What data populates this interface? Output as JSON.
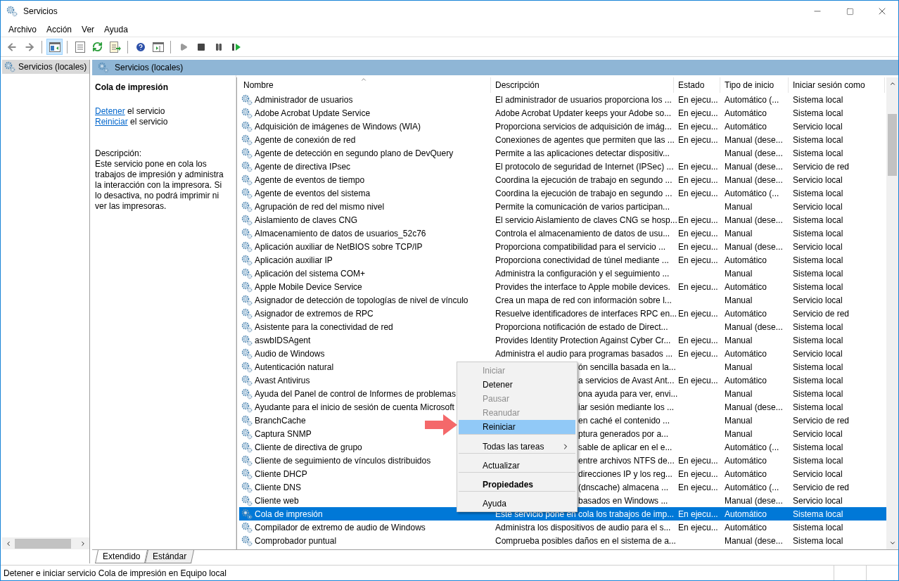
{
  "window": {
    "title": "Servicios"
  },
  "menu_bar": [
    "Archivo",
    "Acción",
    "Ver",
    "Ayuda"
  ],
  "toolbar": {
    "console_tree_shown": true
  },
  "tree": [
    {
      "label": "Servicios (locales)",
      "selected": true
    }
  ],
  "panel_title": "Servicios (locales)",
  "details": {
    "service_name": "Cola de impresión",
    "actions": [
      {
        "link": "Detener",
        "text": "el servicio"
      },
      {
        "link": "Reiniciar",
        "text": "el servicio"
      }
    ],
    "description_label": "Descripción:",
    "description": "Este servicio pone en cola los trabajos de impresión y administra la interacción con la impresora. Si lo desactiva, no podrá imprimir ni ver las impresoras."
  },
  "table": {
    "columns": [
      "Nombre",
      "Descripción",
      "Estado",
      "Tipo de inicio",
      "Iniciar sesión como"
    ],
    "rows": [
      {
        "name": "Administrador de usuarios",
        "description": "El administrador de usuarios proporciona los ...",
        "status": "En ejecu...",
        "startup": "Automático (...",
        "logon": "Sistema local",
        "selected": false,
        "covered": false
      },
      {
        "name": "Adobe Acrobat Update Service",
        "description": "Adobe Acrobat Updater keeps your Adobe so...",
        "status": "En ejecu...",
        "startup": "Automático",
        "logon": "Sistema local",
        "selected": false,
        "covered": false
      },
      {
        "name": "Adquisición de imágenes de Windows (WIA)",
        "description": "Proporciona servicios de adquisición de imág...",
        "status": "En ejecu...",
        "startup": "Automático",
        "logon": "Servicio local",
        "selected": false,
        "covered": false
      },
      {
        "name": "Agente de conexión de red",
        "description": "Conexiones de agentes que permiten que las ...",
        "status": "En ejecu...",
        "startup": "Manual (dese...",
        "logon": "Sistema local",
        "selected": false,
        "covered": false
      },
      {
        "name": "Agente de detección en segundo plano de DevQuery",
        "description": "Permite a las aplicaciones detectar dispositiv...",
        "status": "",
        "startup": "Manual (dese...",
        "logon": "Sistema local",
        "selected": false,
        "covered": false
      },
      {
        "name": "Agente de directiva IPsec",
        "description": "El protocolo de seguridad de Internet (IPSec) ...",
        "status": "En ejecu...",
        "startup": "Manual (dese...",
        "logon": "Servicio de red",
        "selected": false,
        "covered": false
      },
      {
        "name": "Agente de eventos de tiempo",
        "description": "Coordina la ejecución de trabajo en segundo ...",
        "status": "En ejecu...",
        "startup": "Manual (dese...",
        "logon": "Servicio local",
        "selected": false,
        "covered": false
      },
      {
        "name": "Agente de eventos del sistema",
        "description": "Coordina la ejecución de trabajo en segundo ...",
        "status": "En ejecu...",
        "startup": "Automático (...",
        "logon": "Sistema local",
        "selected": false,
        "covered": false
      },
      {
        "name": "Agrupación de red del mismo nivel",
        "description": "Permite la comunicación de varios participan...",
        "status": "",
        "startup": "Manual",
        "logon": "Servicio local",
        "selected": false,
        "covered": false
      },
      {
        "name": "Aislamiento de claves CNG",
        "description": "El servicio Aislamiento de claves CNG se hosp...",
        "status": "En ejecu...",
        "startup": "Manual (dese...",
        "logon": "Sistema local",
        "selected": false,
        "covered": false
      },
      {
        "name": "Almacenamiento de datos de usuarios_52c76",
        "description": "Controla el almacenamiento de datos de usu...",
        "status": "En ejecu...",
        "startup": "Manual",
        "logon": "Sistema local",
        "selected": false,
        "covered": false
      },
      {
        "name": "Aplicación auxiliar de NetBIOS sobre TCP/IP",
        "description": "Proporciona compatibilidad para el servicio ...",
        "status": "En ejecu...",
        "startup": "Manual (dese...",
        "logon": "Servicio local",
        "selected": false,
        "covered": false
      },
      {
        "name": "Aplicación auxiliar IP",
        "description": "Proporciona conectividad de túnel mediante ...",
        "status": "En ejecu...",
        "startup": "Automático",
        "logon": "Sistema local",
        "selected": false,
        "covered": false
      },
      {
        "name": "Aplicación del sistema COM+",
        "description": "Administra la configuración y el seguimiento ...",
        "status": "",
        "startup": "Manual",
        "logon": "Sistema local",
        "selected": false,
        "covered": false
      },
      {
        "name": "Apple Mobile Device Service",
        "description": "Provides the interface to Apple mobile devices.",
        "status": "En ejecu...",
        "startup": "Automático",
        "logon": "Sistema local",
        "selected": false,
        "covered": false
      },
      {
        "name": "Asignador de detección de topologías de nivel de vínculo",
        "description": "Crea un mapa de red con información sobre l...",
        "status": "",
        "startup": "Manual",
        "logon": "Servicio local",
        "selected": false,
        "covered": false
      },
      {
        "name": "Asignador de extremos de RPC",
        "description": "Resuelve identificadores de interfaces RPC en...",
        "status": "En ejecu...",
        "startup": "Automático",
        "logon": "Servicio de red",
        "selected": false,
        "covered": false
      },
      {
        "name": "Asistente para la conectividad de red",
        "description": "Proporciona notificación de estado de Direct...",
        "status": "",
        "startup": "Manual (dese...",
        "logon": "Sistema local",
        "selected": false,
        "covered": false
      },
      {
        "name": "aswbIDSAgent",
        "description": "Provides Identity Protection Against Cyber Cr...",
        "status": "En ejecu...",
        "startup": "Manual",
        "logon": "Sistema local",
        "selected": false,
        "covered": false
      },
      {
        "name": "Audio de Windows",
        "description": "Administra el audio para programas basados ...",
        "status": "En ejecu...",
        "startup": "Automático",
        "logon": "Servicio local",
        "selected": false,
        "covered": false
      },
      {
        "name": "Autenticación natural",
        "description": "ón sencilla basada en la...",
        "status": "",
        "startup": "Manual",
        "logon": "Sistema local",
        "selected": false,
        "covered": true
      },
      {
        "name": "Avast Antivirus",
        "description": "a servicios de Avast Ant...",
        "status": "En ejecu...",
        "startup": "Automático",
        "logon": "Sistema local",
        "selected": false,
        "covered": true
      },
      {
        "name": "Ayuda del Panel de control de Informes de problemas",
        "description": "ona ayuda para ver, envi...",
        "status": "",
        "startup": "Manual",
        "logon": "Sistema local",
        "selected": false,
        "covered": true
      },
      {
        "name": "Ayudante para el inicio de sesión de cuenta Microsoft",
        "description": "iar sesión mediante los ...",
        "status": "",
        "startup": "Manual (dese...",
        "logon": "Sistema local",
        "selected": false,
        "covered": true
      },
      {
        "name": "BranchCache",
        "description": "en caché el contenido ...",
        "status": "",
        "startup": "Manual",
        "logon": "Servicio de red",
        "selected": false,
        "covered": true
      },
      {
        "name": "Captura SNMP",
        "description": "ptura generados por a...",
        "status": "",
        "startup": "Manual",
        "logon": "Servicio local",
        "selected": false,
        "covered": true
      },
      {
        "name": "Cliente de directiva de grupo",
        "description": "sable de aplicar en el e...",
        "status": "",
        "startup": "Automático (...",
        "logon": "Sistema local",
        "selected": false,
        "covered": true
      },
      {
        "name": "Cliente de seguimiento de vínculos distribuidos",
        "description": "entre archivos NTFS de...",
        "status": "En ejecu...",
        "startup": "Automático",
        "logon": "Sistema local",
        "selected": false,
        "covered": true
      },
      {
        "name": "Cliente DHCP",
        "description": "direcciones IP y los reg...",
        "status": "En ejecu...",
        "startup": "Automático",
        "logon": "Servicio local",
        "selected": false,
        "covered": true
      },
      {
        "name": "Cliente DNS",
        "description": "(dnscache) almacena ...",
        "status": "En ejecu...",
        "startup": "Automático (...",
        "logon": "Servicio de red",
        "selected": false,
        "covered": true
      },
      {
        "name": "Cliente web",
        "description": "basados en Windows ...",
        "status": "",
        "startup": "Manual (dese...",
        "logon": "Servicio local",
        "selected": false,
        "covered": true
      },
      {
        "name": "Cola de impresión",
        "description": "Este servicio pone en cola los trabajos de imp...",
        "status": "En ejecu...",
        "startup": "Automático",
        "logon": "Sistema local",
        "selected": true,
        "covered": false
      },
      {
        "name": "Compilador de extremo de audio de Windows",
        "description": "Administra los dispositivos de audio para el s...",
        "status": "En ejecu...",
        "startup": "Automático",
        "logon": "Sistema local",
        "selected": false,
        "covered": false
      },
      {
        "name": "Comprobador puntual",
        "description": "Comprueba posibles daños en el sistema de a...",
        "status": "",
        "startup": "Manual (dese...",
        "logon": "Sistema local",
        "selected": false,
        "covered": false
      }
    ]
  },
  "context_menu": [
    {
      "label": "Iniciar",
      "disabled": true,
      "selected": false,
      "separator_before": false,
      "submenu": false,
      "default": false
    },
    {
      "label": "Detener",
      "disabled": false,
      "selected": false,
      "separator_before": false,
      "submenu": false,
      "default": false
    },
    {
      "label": "Pausar",
      "disabled": true,
      "selected": false,
      "separator_before": false,
      "submenu": false,
      "default": false
    },
    {
      "label": "Reanudar",
      "disabled": true,
      "selected": false,
      "separator_before": false,
      "submenu": false,
      "default": false
    },
    {
      "label": "Reiniciar",
      "disabled": false,
      "selected": true,
      "separator_before": false,
      "submenu": false,
      "default": false
    },
    {
      "label": "Todas las tareas",
      "disabled": false,
      "selected": false,
      "separator_before": true,
      "submenu": true,
      "default": false
    },
    {
      "label": "Actualizar",
      "disabled": false,
      "selected": false,
      "separator_before": true,
      "submenu": false,
      "default": false
    },
    {
      "label": "Propiedades",
      "disabled": false,
      "selected": false,
      "separator_before": true,
      "submenu": false,
      "default": true
    },
    {
      "label": "Ayuda",
      "disabled": false,
      "selected": false,
      "separator_before": true,
      "submenu": false,
      "default": false
    }
  ],
  "bottom_tabs": [
    {
      "label": "Extendido",
      "selected": true
    },
    {
      "label": "Estándar",
      "selected": false
    }
  ],
  "status_bar": "Detener e iniciar servicio Cola de impresión en Equipo local"
}
